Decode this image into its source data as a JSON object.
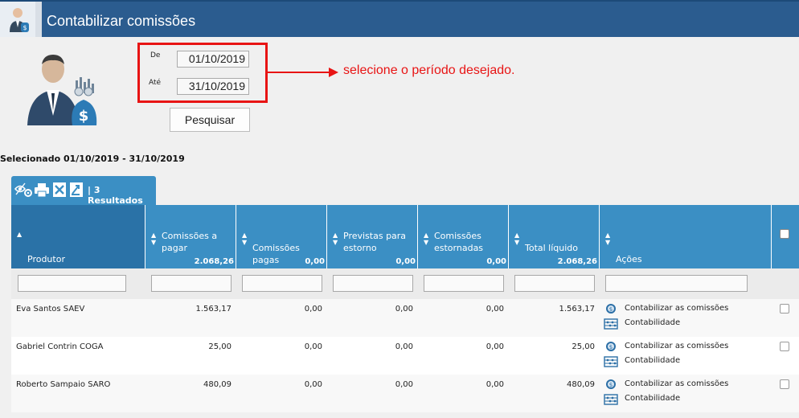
{
  "window": {
    "title": "Contabilizar comissões"
  },
  "form": {
    "from_label": "De",
    "from_value": "01/10/2019",
    "to_label": "Até",
    "to_value": "31/10/2019",
    "search_label": "Pesquisar"
  },
  "annotation": {
    "text": "selecione o período desejado."
  },
  "selected_text": "Selecionado 01/10/2019 - 31/10/2019",
  "toolbar": {
    "results_label": "| 3 Resultados"
  },
  "table": {
    "columns": [
      {
        "label": "Produtor",
        "total": ""
      },
      {
        "label": "Comissões a pagar",
        "total": "2.068,26"
      },
      {
        "label": "Comissões pagas",
        "total": "0,00"
      },
      {
        "label": "Previstas para estorno",
        "total": "0,00"
      },
      {
        "label": "Comissões estornadas",
        "total": "0,00"
      },
      {
        "label": "Total líquido",
        "total": "2.068,26"
      },
      {
        "label": "Ações",
        "total": ""
      }
    ],
    "action_labels": {
      "account": "Contabilizar as comissões",
      "accounting": "Contabilidade"
    },
    "rows": [
      {
        "produtor": "Eva Santos SAEV",
        "a_pagar": "1.563,17",
        "pagas": "0,00",
        "previstas": "0,00",
        "estornadas": "0,00",
        "total": "1.563,17"
      },
      {
        "produtor": "Gabriel Contrin COGA",
        "a_pagar": "25,00",
        "pagas": "0,00",
        "previstas": "0,00",
        "estornadas": "0,00",
        "total": "25,00"
      },
      {
        "produtor": "Roberto Sampaio SARO",
        "a_pagar": "480,09",
        "pagas": "0,00",
        "previstas": "0,00",
        "estornadas": "0,00",
        "total": "480,09"
      }
    ]
  },
  "colors": {
    "header_blue": "#3b8fc4",
    "title_blue": "#2b5c8f",
    "annotation_red": "#e81414"
  },
  "icons": [
    "money-bag-user-icon",
    "settings-eye-icon",
    "print-icon",
    "excel-icon",
    "export-icon",
    "coin-icon",
    "abacus-icon",
    "sort-icon"
  ]
}
